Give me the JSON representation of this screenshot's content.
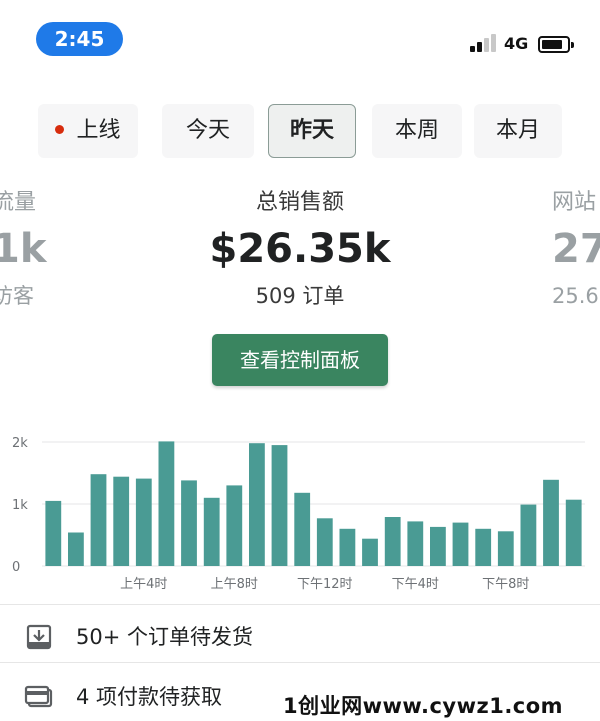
{
  "status_bar": {
    "time": "2:45",
    "network": "4G",
    "accent": "#1f7ae8"
  },
  "tabs": [
    {
      "label": "上线",
      "has_dot": true
    },
    {
      "label": "今天"
    },
    {
      "label": "昨天",
      "active": true
    },
    {
      "label": "本周"
    },
    {
      "label": "本月"
    }
  ],
  "metrics": {
    "left": {
      "label": "流量",
      "value": "1k",
      "sub": "访客"
    },
    "center": {
      "label": "总销售额",
      "value": "$26.35k",
      "sub": "509 订单"
    },
    "right": {
      "label": "网站",
      "value": "27",
      "sub": "25.6"
    }
  },
  "dashboard_button": {
    "label": "查看控制面板",
    "color": "#3a8560"
  },
  "chart_data": {
    "type": "bar",
    "color": "#4a9b94",
    "ylim": [
      0,
      2000
    ],
    "yticks": [
      "0",
      "1k",
      "2k"
    ],
    "xtick_labels": [
      "上午4时",
      "上午8时",
      "下午12时",
      "下午4时",
      "下午8时"
    ],
    "values": [
      1050,
      540,
      1480,
      1440,
      1410,
      2010,
      1380,
      1100,
      1300,
      1980,
      1950,
      1180,
      770,
      600,
      440,
      790,
      720,
      630,
      700,
      600,
      560,
      990,
      1390,
      1070
    ]
  },
  "tasks": [
    {
      "label": "50+ 个订单待发货",
      "icon": "download-box-icon"
    },
    {
      "label": "4 项付款待获取",
      "icon": "credit-card-icon"
    }
  ],
  "watermark": "1创业网www.cywz1.com"
}
